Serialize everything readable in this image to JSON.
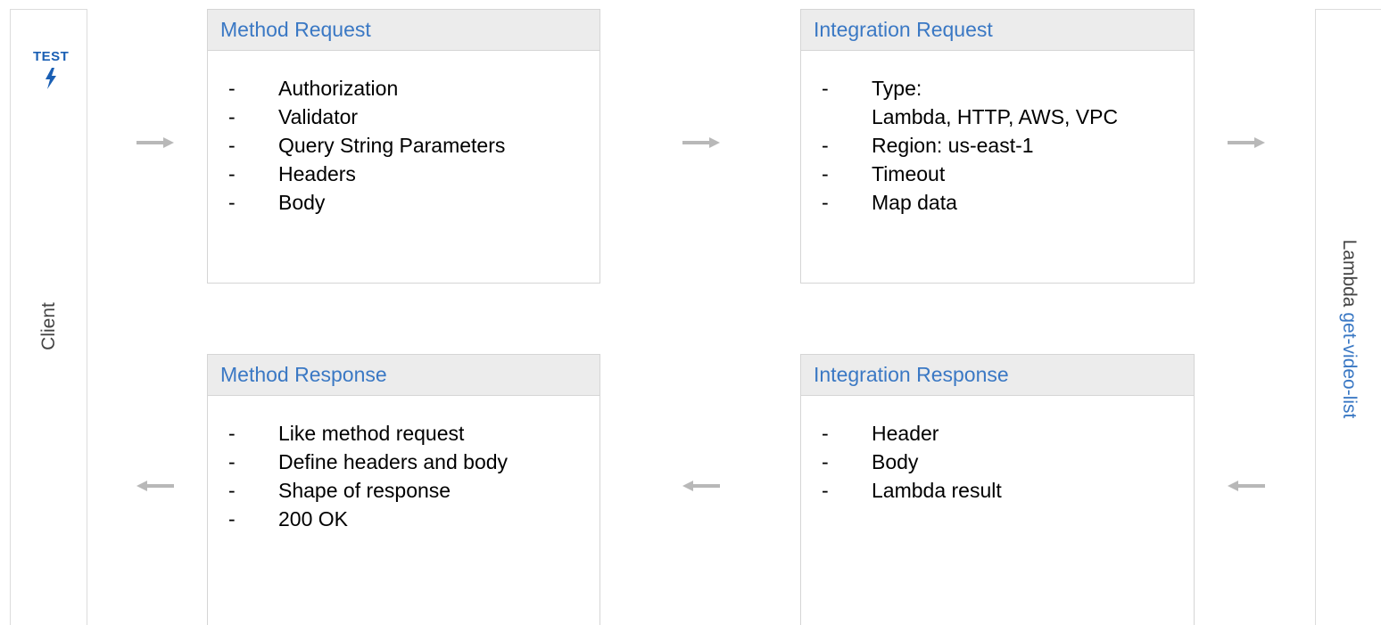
{
  "client": {
    "test_label": "TEST",
    "icon": "lightning-bolt-icon",
    "label": "Client"
  },
  "lambda": {
    "prefix": "Lambda",
    "function_name": "get-video-list"
  },
  "method_request": {
    "title": "Method Request",
    "items": [
      "Authorization",
      "Validator",
      "Query String Parameters",
      "Headers",
      "Body"
    ]
  },
  "integration_request": {
    "title": "Integration Request",
    "items": [
      "Type:",
      "Region: us-east-1",
      "Timeout",
      "Map data"
    ],
    "type_values": "Lambda, HTTP, AWS, VPC"
  },
  "method_response": {
    "title": "Method Response",
    "items": [
      "Like method request",
      "Define headers and body",
      "Shape of response",
      "200 OK"
    ]
  },
  "integration_response": {
    "title": "Integration Response",
    "items": [
      "Header",
      "Body",
      "Lambda result"
    ]
  },
  "bullet": "-",
  "colors": {
    "link_blue": "#3a78c4",
    "test_blue": "#1a5fb4",
    "arrow_gray": "#b8b8b8",
    "header_bg": "#ececec",
    "border": "#d5d5d5"
  }
}
